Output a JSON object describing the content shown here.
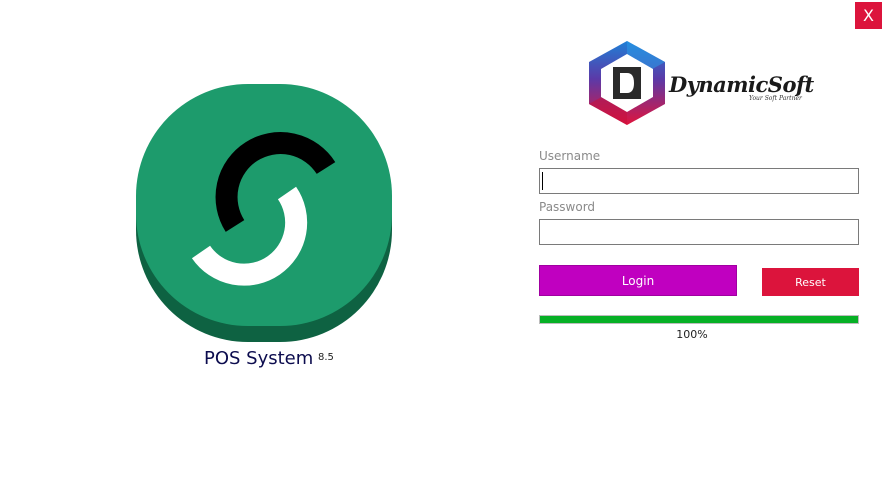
{
  "window": {
    "close_label": "X"
  },
  "app": {
    "name": "POS System",
    "version": "8.5"
  },
  "brand": {
    "name": "DynamicSoft",
    "tagline": "Your Soft Partner",
    "logo_letter": "D"
  },
  "form": {
    "username_label": "Username",
    "username_value": "",
    "password_label": "Password",
    "password_value": "",
    "login_label": "Login",
    "reset_label": "Reset"
  },
  "progress": {
    "value": 100,
    "text": "100%"
  },
  "colors": {
    "close": "#dc143c",
    "login": "#c000c0",
    "reset": "#dc143c",
    "progress": "#06b025",
    "app_icon": "#1d9b6c"
  },
  "icons": {
    "app": "pos-s-logo-icon",
    "brand": "hexagon-d-logo-icon"
  }
}
